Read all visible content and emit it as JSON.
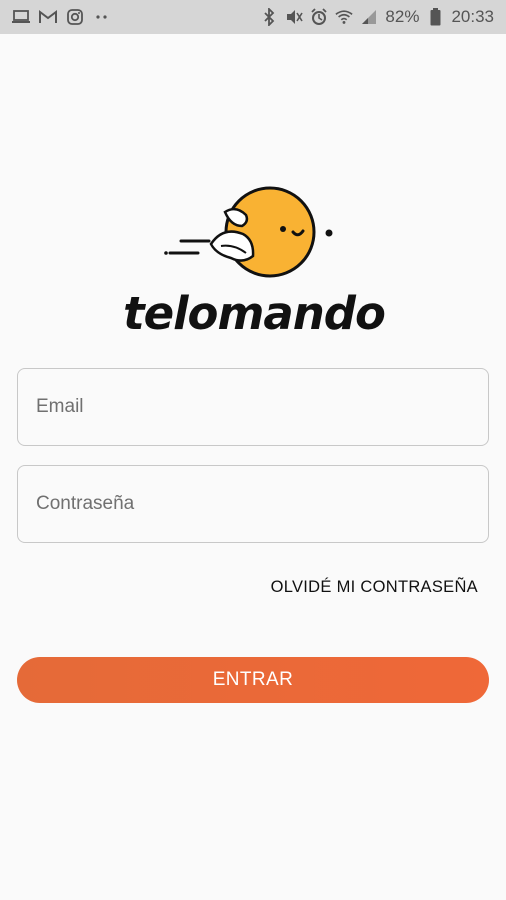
{
  "status_bar": {
    "battery_percent": "82%",
    "time": "20:33",
    "icons": [
      "laptop-icon",
      "gmail-icon",
      "instagram-icon",
      "dots-icon",
      "bluetooth-icon",
      "mute-icon",
      "alarm-icon",
      "wifi-icon",
      "signal-icon",
      "battery-icon"
    ]
  },
  "logo": {
    "text": "telomando",
    "mascot_color": "#f9b233"
  },
  "form": {
    "email_placeholder": "Email",
    "password_placeholder": "Contraseña",
    "forgot_password_label": "OLVIDÉ MI CONTRASEÑA",
    "login_label": "ENTRAR"
  },
  "colors": {
    "accent": "#e9683a",
    "background": "#fafafa",
    "status_bar": "#d6d6d6"
  }
}
